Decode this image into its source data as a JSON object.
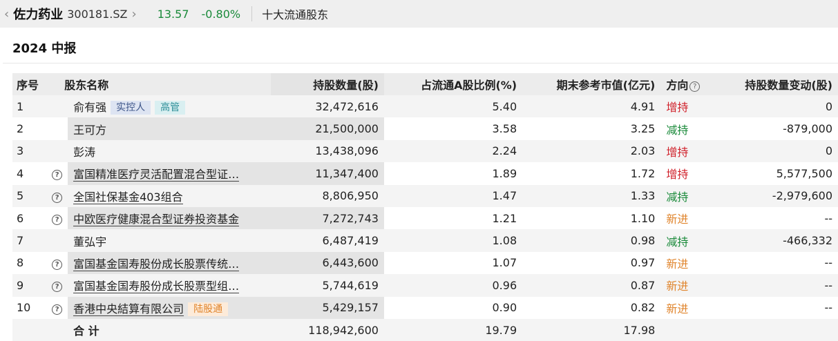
{
  "topbar": {
    "back": "‹",
    "forward": "›",
    "stock_name": "佐力药业",
    "stock_code": "300181.SZ",
    "price": "13.57",
    "change_pct": "-0.80%",
    "section_title": "十大流通股东"
  },
  "period": "2024 中报",
  "colors": {
    "up": "#d0202a",
    "down": "#1a8a3a",
    "new": "#e0852d"
  },
  "table": {
    "headers": {
      "index": "序号",
      "name": "股东名称",
      "shares": "持股数量(股)",
      "ratio": "占流通A股比例(%)",
      "value": "期末参考市值(亿元)",
      "direction": "方向",
      "change": "持股数量变动(股)"
    },
    "help_glyph": "?",
    "rows": [
      {
        "index": "1",
        "name": "俞有强",
        "tags": [
          "实控人",
          "高管"
        ],
        "shares": "32,472,616",
        "ratio": "5.40",
        "value": "4.91",
        "direction": "增持",
        "change": "0"
      },
      {
        "index": "2",
        "name": "王可方",
        "tags": [],
        "shares": "21,500,000",
        "ratio": "3.58",
        "value": "3.25",
        "direction": "减持",
        "change": "-879,000"
      },
      {
        "index": "3",
        "name": "彭涛",
        "tags": [],
        "shares": "13,438,096",
        "ratio": "2.24",
        "value": "2.03",
        "direction": "增持",
        "change": "0"
      },
      {
        "index": "4",
        "name": "富国精准医疗灵活配置混合型证…",
        "tags": [],
        "shares": "11,347,400",
        "ratio": "1.89",
        "value": "1.72",
        "direction": "增持",
        "change": "5,577,500"
      },
      {
        "index": "5",
        "name": "全国社保基金403组合",
        "tags": [],
        "shares": "8,806,950",
        "ratio": "1.47",
        "value": "1.33",
        "direction": "减持",
        "change": "-2,979,600"
      },
      {
        "index": "6",
        "name": "中欧医疗健康混合型证券投资基金",
        "tags": [],
        "shares": "7,272,743",
        "ratio": "1.21",
        "value": "1.10",
        "direction": "新进",
        "change": "--"
      },
      {
        "index": "7",
        "name": "董弘宇",
        "tags": [],
        "shares": "6,487,419",
        "ratio": "1.08",
        "value": "0.98",
        "direction": "减持",
        "change": "-466,332"
      },
      {
        "index": "8",
        "name": "富国基金国寿股份成长股票传统…",
        "tags": [],
        "shares": "6,443,600",
        "ratio": "1.07",
        "value": "0.97",
        "direction": "新进",
        "change": "--"
      },
      {
        "index": "9",
        "name": "富国基金国寿股份成长股票型组…",
        "tags": [],
        "shares": "5,744,619",
        "ratio": "0.96",
        "value": "0.87",
        "direction": "新进",
        "change": "--"
      },
      {
        "index": "10",
        "name": "香港中央結算有限公司",
        "tags": [
          "陆股通"
        ],
        "shares": "5,429,157",
        "ratio": "0.90",
        "value": "0.82",
        "direction": "新进",
        "change": "--"
      }
    ],
    "total": {
      "label": "合 计",
      "shares": "118,942,600",
      "ratio": "19.79",
      "value": "17.98"
    }
  }
}
